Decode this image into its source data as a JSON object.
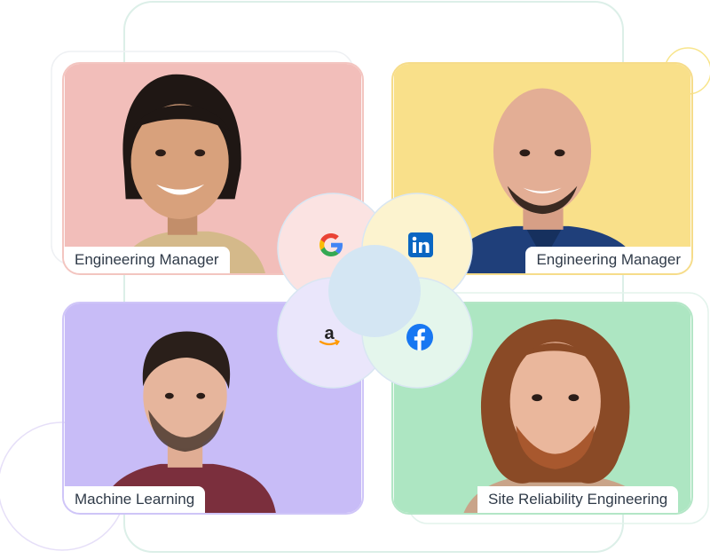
{
  "colors": {
    "tl_bg": "#f2beba",
    "tr_bg": "#f9e08a",
    "bl_bg": "#c8bcf7",
    "br_bg": "#ade6c2"
  },
  "cards": [
    {
      "id": "top-left",
      "title": "Engineering Manager",
      "company": "Google",
      "logo_icon": "google-logo-icon"
    },
    {
      "id": "top-right",
      "title": "Engineering Manager",
      "company": "LinkedIn",
      "logo_icon": "linkedin-logo-icon"
    },
    {
      "id": "bottom-left",
      "title": "Machine Learning",
      "company": "Amazon",
      "logo_icon": "amazon-logo-icon"
    },
    {
      "id": "bottom-right",
      "title": "Site Reliability Engineering",
      "company": "Facebook",
      "logo_icon": "facebook-logo-icon"
    }
  ]
}
